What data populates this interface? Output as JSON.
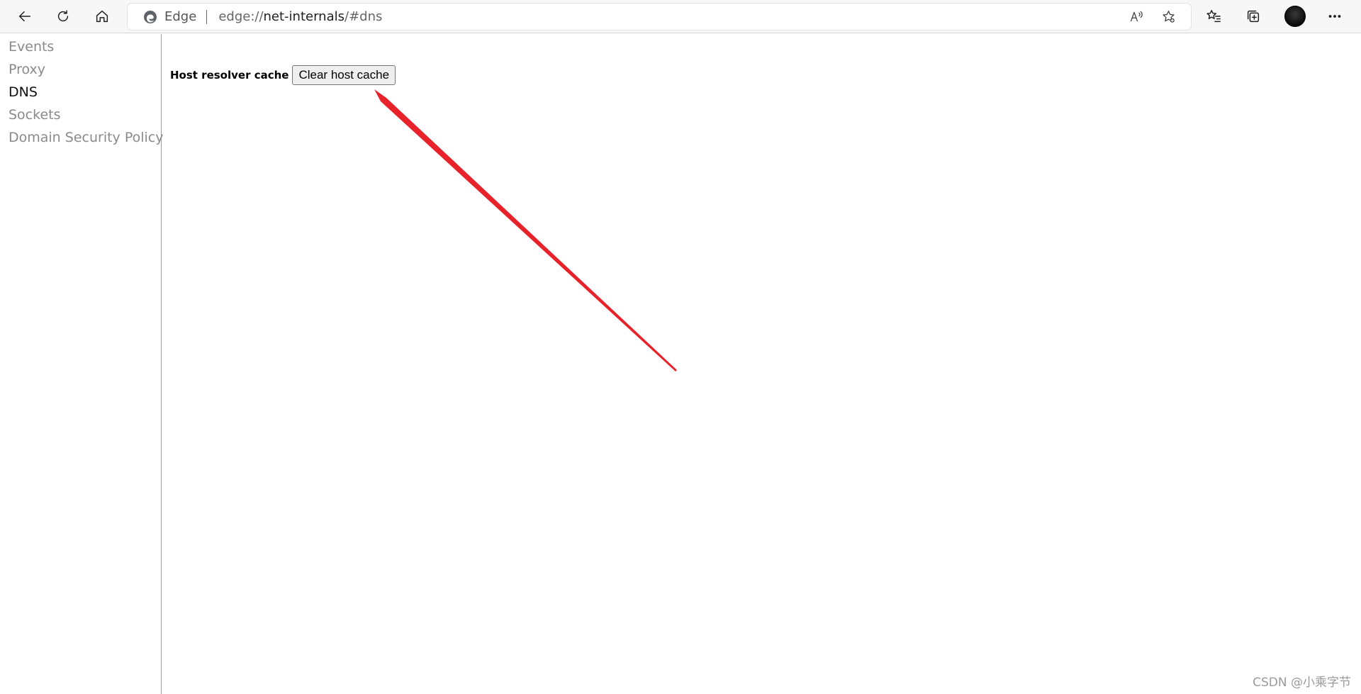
{
  "toolbar": {
    "back_icon": "back-arrow-icon",
    "reload_icon": "reload-icon",
    "home_icon": "home-icon",
    "favorites_icon": "favorites-list-icon",
    "collections_icon": "collections-icon",
    "more_icon": "more-dots-icon"
  },
  "address_bar": {
    "site_name": "Edge",
    "url_prefix": "edge://",
    "url_host": "net-internals",
    "url_suffix": "/#dns",
    "read_aloud_icon": "read-aloud-icon",
    "add_favorite_icon": "add-favorite-star-icon"
  },
  "sidebar": {
    "items": [
      {
        "label": "Events",
        "active": false
      },
      {
        "label": "Proxy",
        "active": false
      },
      {
        "label": "DNS",
        "active": true
      },
      {
        "label": "Sockets",
        "active": false
      },
      {
        "label": "Domain Security Policy",
        "active": false
      }
    ]
  },
  "main": {
    "cache_label": "Host resolver cache",
    "clear_button_label": "Clear host cache"
  },
  "annotation": {
    "arrow_color": "#e8222a"
  },
  "watermark": "CSDN @小乘字节"
}
